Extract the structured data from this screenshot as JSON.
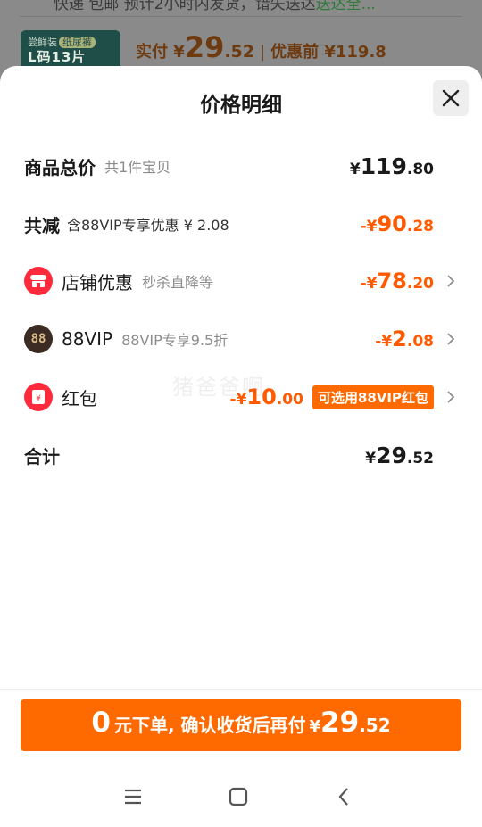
{
  "background": {
    "top_text": "快递 包邮 预计2小时内发货，错失送达",
    "top_text_highlight": "送达全...",
    "thumb_brand": "尝鲜装",
    "thumb_tag": "纸尿裤",
    "thumb_size": "L码13片",
    "price_label": "实付",
    "price_currency": "¥",
    "price_int": "29",
    "price_dec": ".52",
    "price_sep": "|",
    "orig_price": "优惠前 ¥119.8"
  },
  "sheet": {
    "title": "价格明细",
    "close_icon": "close-icon",
    "watermark": "猪爸爸啊"
  },
  "rows": {
    "total": {
      "label": "商品总价",
      "sub": "共1件宝贝",
      "cur": "¥",
      "int": "119",
      "dec": ".80"
    },
    "reduce": {
      "label": "共减",
      "sub": "含88VIP专享优惠 ¥ 2.08",
      "cur": "-¥",
      "int": "90",
      "dec": ".28"
    },
    "shop": {
      "label": "店铺优惠",
      "sub": "秒杀直降等",
      "cur": "-¥",
      "int": "78",
      "dec": ".20",
      "icon": "shop-icon"
    },
    "vip": {
      "label": "88VIP",
      "sub": "88VIP专享9.5折",
      "cur": "-¥",
      "int": "2",
      "dec": ".08",
      "icon_text": "88"
    },
    "redpacket": {
      "label": "红包",
      "cur": "-¥",
      "int": "10",
      "dec": ".00",
      "pill": "可选用88VIP红包",
      "icon": "red-packet-icon"
    },
    "sum": {
      "label": "合计",
      "cur": "¥",
      "int": "29",
      "dec": ".52"
    }
  },
  "cta": {
    "zero": "0",
    "text": "元下单, 确认收货后再付",
    "cur": "¥",
    "int": "29",
    "dec": ".52"
  },
  "navbar": {
    "menu_icon": "menu-icon",
    "home_icon": "home-icon",
    "back_icon": "back-icon"
  },
  "colors": {
    "accent": "#ff6a00",
    "discount": "#ff5a00",
    "icon_red": "#ff2a3b",
    "vip_dark": "#3b2b22"
  }
}
